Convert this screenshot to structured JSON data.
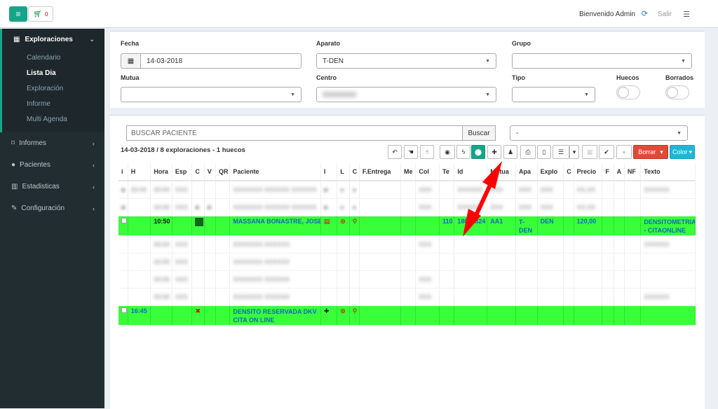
{
  "topbar": {
    "cart_count": "0",
    "welcome": "Bienvenido Admin",
    "logout": "Salir"
  },
  "sidebar": {
    "section": "Exploraciones",
    "subitems": [
      "Calendario",
      "Lista Dia",
      "Exploración",
      "Informe",
      "Multi Agenda"
    ],
    "items": [
      "Informes",
      "Pacientes",
      "Estadisticas",
      "Configuración"
    ]
  },
  "filters": {
    "fecha_label": "Fecha",
    "fecha_value": "14-03-2018",
    "aparato_label": "Aparato",
    "aparato_value": "T-DEN",
    "grupo_label": "Grupo",
    "mutua_label": "Mutua",
    "centro_label": "Centro",
    "tipo_label": "Tipo",
    "huecos_label": "Huecos",
    "borrados_label": "Borrados"
  },
  "list": {
    "search_placeholder": "BUSCAR PACIENTE",
    "search_button": "Buscar",
    "select_value": "-",
    "summary": "14-03-2018 / 8 exploraciones - 1 huecos",
    "borrar": "Borrar",
    "color": "Color"
  },
  "table": {
    "headers": [
      "i",
      "H",
      "Hora",
      "Esp",
      "C",
      "V",
      "QR",
      "Paciente",
      "I",
      "L",
      "C",
      "F.Entrega",
      "Me",
      "Col",
      "Te",
      "Id",
      "Mutua",
      "Apa",
      "Explo",
      "C",
      "Precio",
      "F",
      "A",
      "NF",
      "Texto"
    ],
    "row1": {
      "hora": "10:50",
      "paciente": "MASSANA BONASTRE, JOSEP",
      "te": "110",
      "id": "18041324",
      "mutua": "AA1",
      "apa": "T-DEN",
      "explo": "DEN",
      "precio": "120,00",
      "texto": "DENSITOMETRIA - CITAONLINE"
    },
    "row2": {
      "h": "16:45",
      "paciente": "DENSITO RESERVADA DKV CITA ON LINE"
    }
  }
}
